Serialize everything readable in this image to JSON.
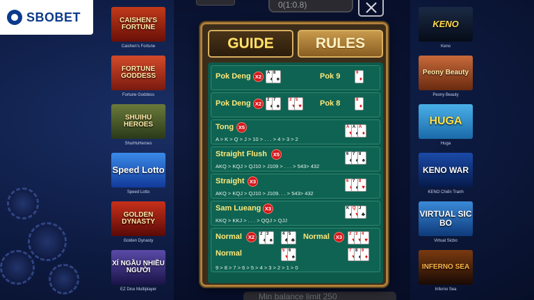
{
  "brand": {
    "logo_text": "SBOBET"
  },
  "games_left": [
    {
      "thumb_text": "CAISHEN'S FORTUNE",
      "caption": "Caishen's Fortune",
      "color": "#8a1c10"
    },
    {
      "thumb_text": "FORTUNE GODDESS",
      "caption": "Fortune Goddess",
      "color": "#a8241a"
    },
    {
      "thumb_text": "SHUIHU HEROES",
      "caption": "ShuiHuHeroes",
      "color": "#3c5a2a"
    },
    {
      "thumb_text": "Speed Lotto",
      "caption": "Speed Lotto",
      "color": "#1a4fbf"
    },
    {
      "thumb_text": "GOLDEN DYNASTY",
      "caption": "Golden Dynasty",
      "color": "#8a1a18"
    },
    {
      "thumb_text": "XÍ NGẦU NHIỀU NGƯỜI",
      "caption": "EZ Dice Multiplayer",
      "color": "#3a2a6a"
    }
  ],
  "games_right": [
    {
      "thumb_text": "KENO",
      "caption": "Keno",
      "color": "#101a2a"
    },
    {
      "thumb_text": "Peony Beauty",
      "caption": "Peony Beauty",
      "color": "#8a3a18"
    },
    {
      "thumb_text": "HUGA",
      "caption": "Huga",
      "color": "#2a8acb"
    },
    {
      "thumb_text": "KENO WAR",
      "caption": "KENO Chiến Tranh",
      "color": "#0a2a6a"
    },
    {
      "thumb_text": "VIRTUAL SIC BO",
      "caption": "Virtual Sicbo",
      "color": "#1a5aa8"
    },
    {
      "thumb_text": "INFERNO SEA",
      "caption": "Inferno Sea",
      "color": "#3a1a08"
    }
  ],
  "top_field": {
    "value": "0(1:0.8)"
  },
  "bottom_field": {
    "value": "Min balance limit 250"
  },
  "modal": {
    "tabs": [
      {
        "label": "GUIDE"
      },
      {
        "label": "RULES"
      }
    ],
    "rows": {
      "pokdeng9": {
        "label": "Pok Deng",
        "mult": "X2",
        "label2": "Pok 9"
      },
      "pokdeng8": {
        "label": "Pok Deng",
        "mult": "X2",
        "label2": "Pok 8"
      },
      "tong": {
        "label": "Tong",
        "mult": "X5",
        "sub": "A > K > Q > J > 10 > . . . > 4 > 3 > 2"
      },
      "straight_flush": {
        "label": "Straight Flush",
        "mult": "X5",
        "sub": "AKQ > KQJ > QJ10 > J109 > . . . > 543> 432"
      },
      "straight": {
        "label": "Straight",
        "mult": "X3",
        "sub": "AKQ > KQJ > QJ10 > J109. . . > 543> 432"
      },
      "sam_lueang": {
        "label": "Sam Lueang",
        "mult": "X3",
        "sub": "KKQ > KKJ > . . . > QQJ > QJJ"
      },
      "normal": {
        "label_a": "Normal",
        "mult_a": "X2",
        "label_b": "Normal",
        "mult_b": "X3",
        "label_c": "Normal",
        "sub": "9 > 8 > 7 > 6 > 5 > 4 > 3 > 2 > 1 > 0"
      }
    }
  },
  "colors": {
    "accent_gold": "#ffe87a",
    "board_green": "#0d5a4a",
    "badge_red": "#d3191e"
  },
  "icons": {
    "close": "close-icon",
    "logo": "sbobet-logo-icon"
  }
}
